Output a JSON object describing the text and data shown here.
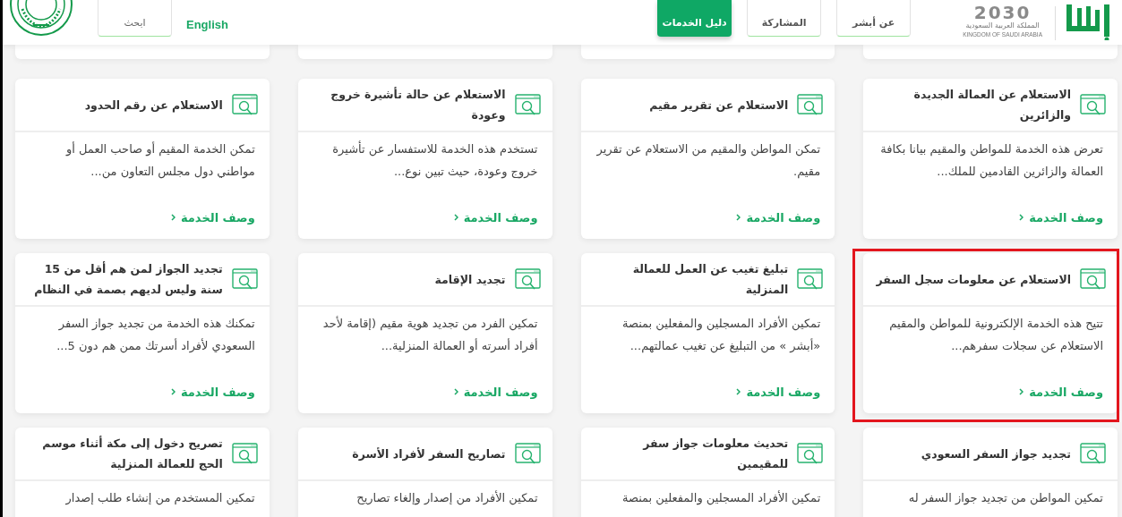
{
  "header": {
    "logo_year": "2030",
    "logo_caption_ar": "المملكة العربية السعودية",
    "logo_caption_en": "KINGDOM OF SAUDI ARABIA",
    "nav": [
      {
        "label": "عن أبشر",
        "selected": false
      },
      {
        "label": "المشاركة",
        "selected": false
      },
      {
        "label": "دليل الخدمات",
        "selected": true
      }
    ],
    "language_link": "English",
    "search_button": "ابحث"
  },
  "services": [
    {
      "title": "الاستعلام عن العمالة الجديدة والزائرين",
      "description": "تعرض هذه الخدمة للمواطن والمقيم بيانا بكافة العمالة والزائرين القادمين للملك...",
      "link": "وصف الخدمة",
      "highlighted": false
    },
    {
      "title": "الاستعلام عن تقرير مقيم",
      "description": "تمكن المواطن والمقيم من الاستعلام عن تقرير مقيم.",
      "link": "وصف الخدمة",
      "highlighted": false
    },
    {
      "title": "الاستعلام عن حالة تأشيرة خروج وعودة",
      "description": "تستخدم هذه الخدمة للاستفسار عن تأشيرة خروج وعودة، حيث تبين نوع...",
      "link": "وصف الخدمة",
      "highlighted": false
    },
    {
      "title": "الاستعلام عن رقم الحدود",
      "description": "تمكن الخدمة المقيم أو صاحب العمل أو مواطني دول مجلس التعاون من...",
      "link": "وصف الخدمة",
      "highlighted": false
    },
    {
      "title": "الاستعلام عن معلومات سجل السفر",
      "description": "تتيح هذه الخدمة الإلكترونية للمواطن والمقيم الاستعلام عن سجلات سفرهم...",
      "link": "وصف الخدمة",
      "highlighted": true
    },
    {
      "title": "تبليغ تغيب عن العمل للعمالة المنزلية",
      "description": "تمكين الأفراد المسجلين والمفعلين بمنصة «أبشر » من التبليغ عن تغيب عمالتهم...",
      "link": "وصف الخدمة",
      "highlighted": false
    },
    {
      "title": "تجديد الإقامة",
      "description": "تمكين الفرد من تجديد هوية مقيم (إقامة لأحد أفراد أسرته أو العمالة المنزلية...",
      "link": "وصف الخدمة",
      "highlighted": false
    },
    {
      "title": "تجديد الجواز لمن هم أقل من 15 سنة وليس لديهم بصمة في النظام",
      "description": "تمكنك هذه الخدمة من تجديد جواز السفر السعودي لأفراد أسرتك ممن هم دون 5...",
      "link": "وصف الخدمة",
      "highlighted": false
    },
    {
      "title": "تجديد جواز السفر السعودي",
      "description": "تمكين المواطن من تجديد جواز السفر له",
      "highlighted": false
    },
    {
      "title": "تحديث معلومات جواز سفر للمقيمين",
      "description": "تمكين الأفراد المسجلين والمفعلين بمنصة",
      "highlighted": false
    },
    {
      "title": "تصاريح السفر لأفراد الأسرة",
      "description": "تمكين الأفراد من إصدار وإلغاء تصاريح",
      "highlighted": false
    },
    {
      "title": "تصريح دخول إلى مكة أثناء موسم الحج للعمالة المنزلية",
      "description": "تمكين المستخدم من إنشاء طلب إصدار",
      "highlighted": false
    }
  ]
}
